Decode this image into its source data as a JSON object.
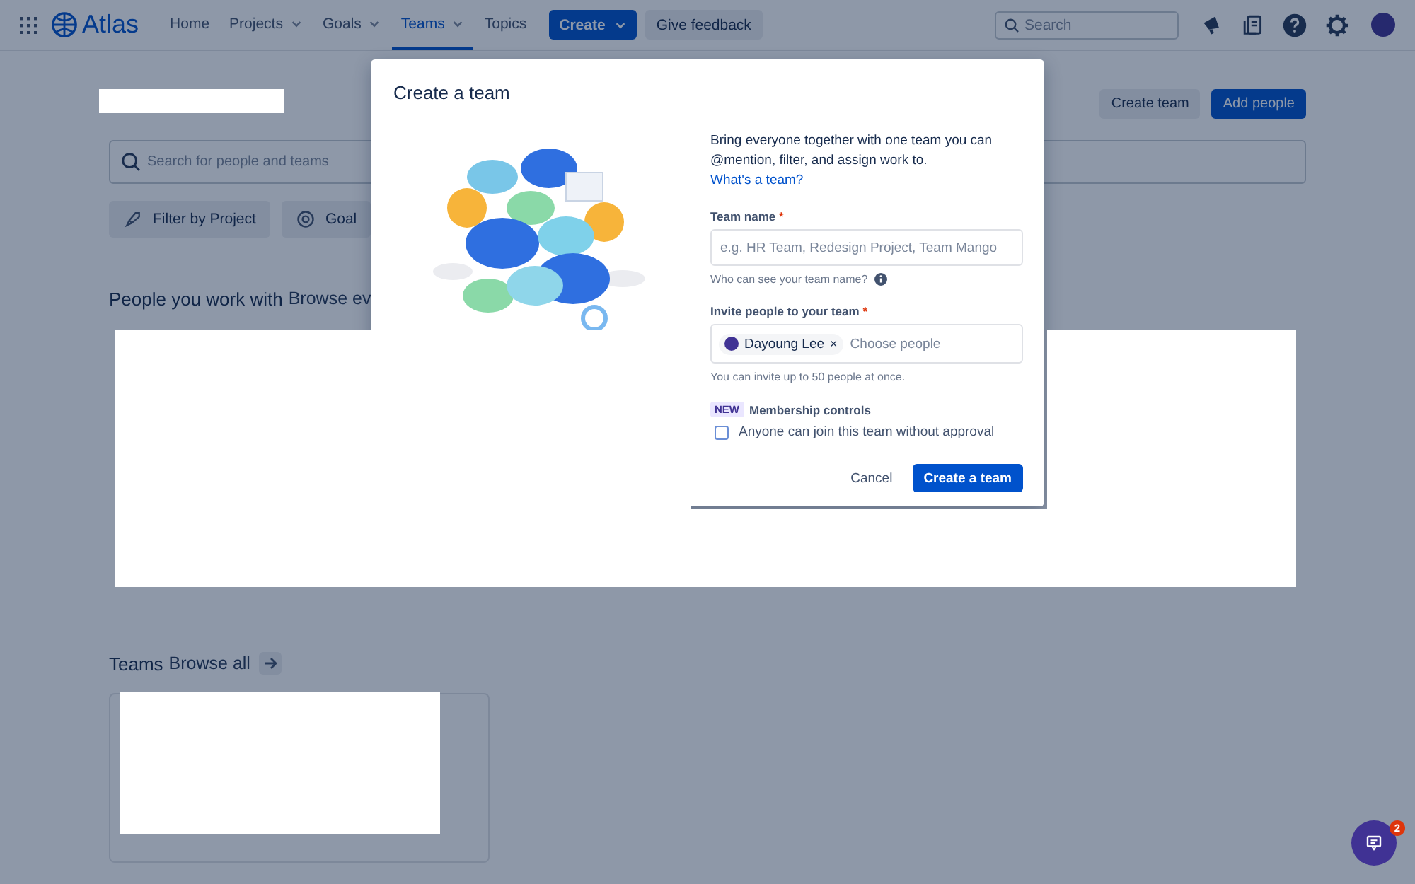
{
  "topbar": {
    "product": "Atlas",
    "nav": [
      {
        "label": "Home",
        "dropdown": false,
        "selected": false
      },
      {
        "label": "Projects",
        "dropdown": true,
        "selected": false
      },
      {
        "label": "Goals",
        "dropdown": true,
        "selected": false
      },
      {
        "label": "Teams",
        "dropdown": true,
        "selected": true
      },
      {
        "label": "Topics",
        "dropdown": false,
        "selected": false
      }
    ],
    "create_button": "Create",
    "feedback_button": "Give feedback",
    "search": {
      "placeholder": "Search"
    }
  },
  "page": {
    "header_buttons": [
      {
        "label": "Create team",
        "kind": "secondary"
      },
      {
        "label": "Add people",
        "kind": "primary"
      }
    ],
    "search": {
      "placeholder": "Search for people and teams"
    },
    "filters": [
      {
        "label": "Filter by Project",
        "kind": "project"
      },
      {
        "label": "Goal",
        "kind": "goal"
      }
    ],
    "people_section": {
      "title": "People you work with",
      "link": "Browse ev"
    },
    "teams_section": {
      "title": "Teams",
      "link": "Browse all"
    }
  },
  "dialog": {
    "title": "Create a team",
    "intro": "Bring everyone together with one team you can @mention, filter, and assign work to.",
    "intro_link": "What's a team?",
    "team_name": {
      "label": "Team name",
      "required_mark": "*",
      "placeholder": "e.g. HR Team, Redesign Project, Team Mango",
      "help": "Who can see your team name?"
    },
    "invite": {
      "label": "Invite people to your team",
      "required_mark": "*",
      "chips": [
        {
          "name": "Dayoung Lee",
          "remove": "×"
        }
      ],
      "placeholder": "Choose people",
      "help": "You can invite up to 50 people at once."
    },
    "membership": {
      "badge": "NEW",
      "title": "Membership controls",
      "option": "Anyone can join this team without approval",
      "checked": false
    },
    "cancel": "Cancel",
    "submit": "Create a team"
  },
  "chat": {
    "badge": "2"
  }
}
